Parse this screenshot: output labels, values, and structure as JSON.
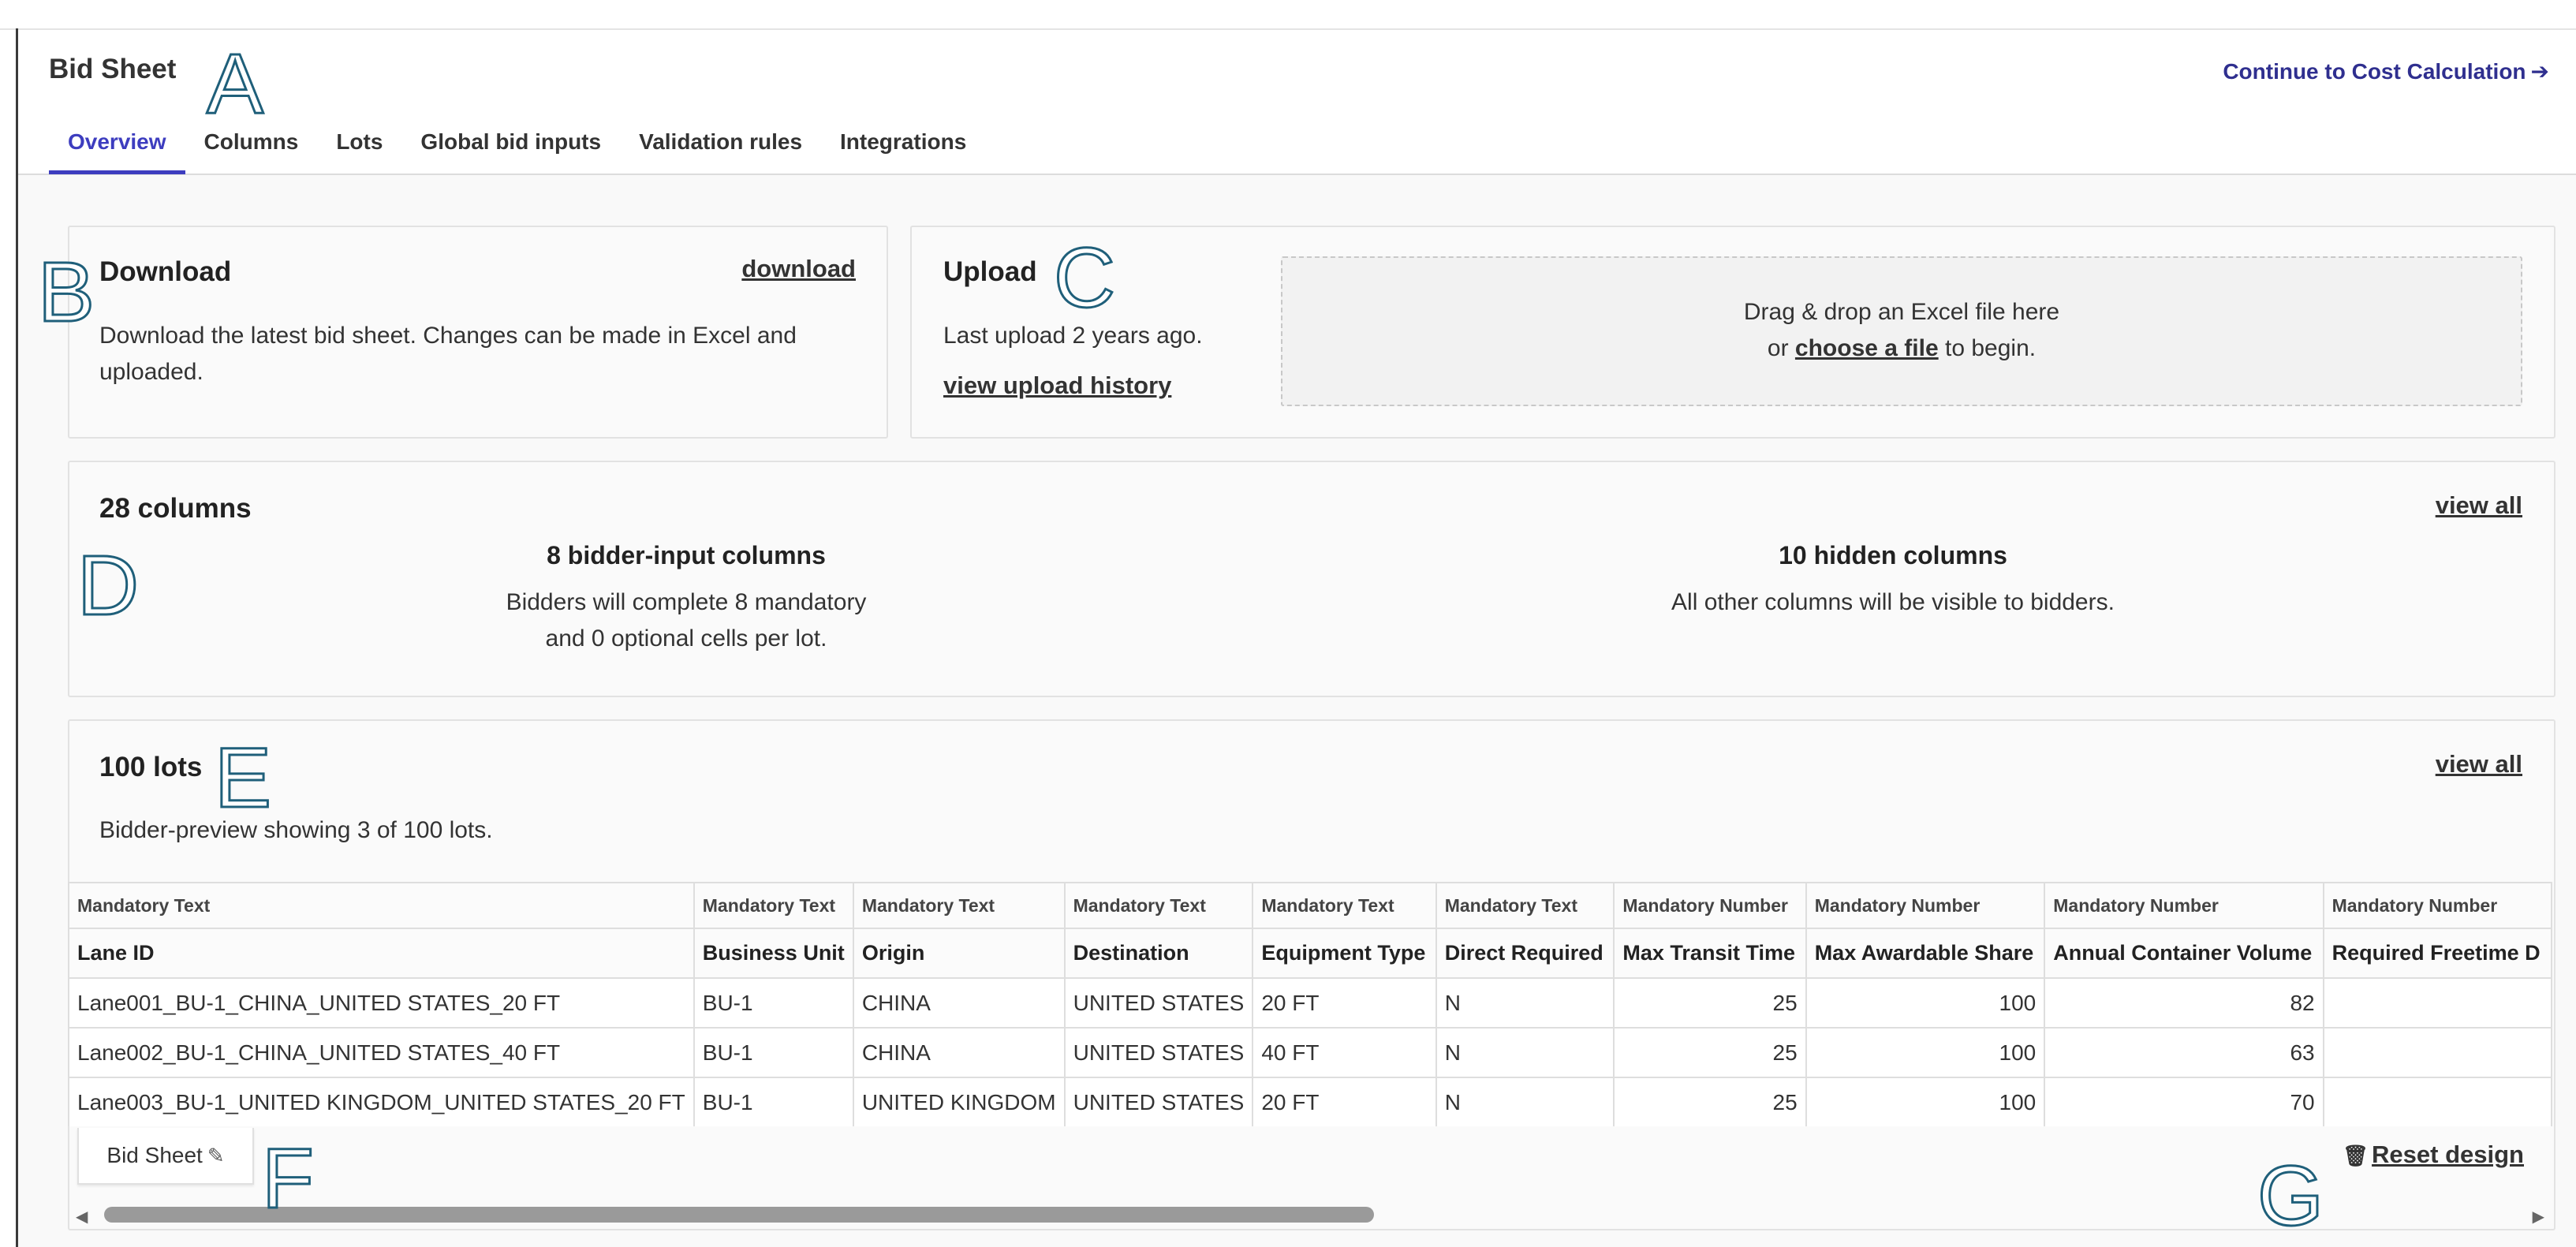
{
  "header": {
    "title": "Bid Sheet",
    "continue_label": "Continue to Cost Calculation",
    "tabs": [
      {
        "label": "Overview",
        "active": true
      },
      {
        "label": "Columns"
      },
      {
        "label": "Lots"
      },
      {
        "label": "Global bid inputs"
      },
      {
        "label": "Validation rules"
      },
      {
        "label": "Integrations"
      }
    ]
  },
  "download": {
    "title": "Download",
    "link": "download",
    "description_line1": "Download the latest bid sheet. Changes can be made in Excel and",
    "description_line2": "uploaded."
  },
  "upload": {
    "title": "Upload",
    "last_upload": "Last upload 2 years ago.",
    "history_link": "view upload history",
    "drop_line1": "Drag & drop an Excel file here",
    "drop_prefix": "or ",
    "drop_link": "choose a file",
    "drop_suffix": " to begin."
  },
  "columns": {
    "title": "28 columns",
    "view_all": "view all",
    "bidder_heading": "8 bidder-input columns",
    "bidder_line1": "Bidders will complete 8 mandatory",
    "bidder_line2": "and 0 optional cells per lot.",
    "hidden_heading": "10 hidden columns",
    "hidden_text": "All other columns will be visible to bidders."
  },
  "lots": {
    "title": "100 lots",
    "view_all": "view all",
    "preview_text": "Bidder-preview showing 3 of 100 lots.",
    "table": {
      "type_row": [
        "Mandatory Text",
        "Mandatory Text",
        "Mandatory Text",
        "Mandatory Text",
        "Mandatory Text",
        "Mandatory Text",
        "Mandatory Number",
        "Mandatory Number",
        "Mandatory Number",
        "Mandatory Number"
      ],
      "headers": [
        "Lane ID",
        "Business Unit",
        "Origin",
        "Destination",
        "Equipment Type",
        "Direct Required",
        "Max Transit Time",
        "Max Awardable Share",
        "Annual Container Volume",
        "Required Freetime D"
      ],
      "rows": [
        [
          "Lane001_BU-1_CHINA_UNITED STATES_20 FT",
          "BU-1",
          "CHINA",
          "UNITED STATES",
          "20 FT",
          "N",
          "25",
          "100",
          "82",
          ""
        ],
        [
          "Lane002_BU-1_CHINA_UNITED STATES_40 FT",
          "BU-1",
          "CHINA",
          "UNITED STATES",
          "40 FT",
          "N",
          "25",
          "100",
          "63",
          ""
        ],
        [
          "Lane003_BU-1_UNITED KINGDOM_UNITED STATES_20 FT",
          "BU-1",
          "UNITED KINGDOM",
          "UNITED STATES",
          "20 FT",
          "N",
          "25",
          "100",
          "70",
          ""
        ]
      ]
    },
    "sheet_tab": "Bid Sheet",
    "reset_label": "Reset design"
  },
  "annotations": [
    "A",
    "B",
    "C",
    "D",
    "E",
    "F",
    "G"
  ],
  "icons": {
    "continue": "arrow-right-icon",
    "sheet_edit": "edit-icon",
    "reset": "trash-icon"
  }
}
